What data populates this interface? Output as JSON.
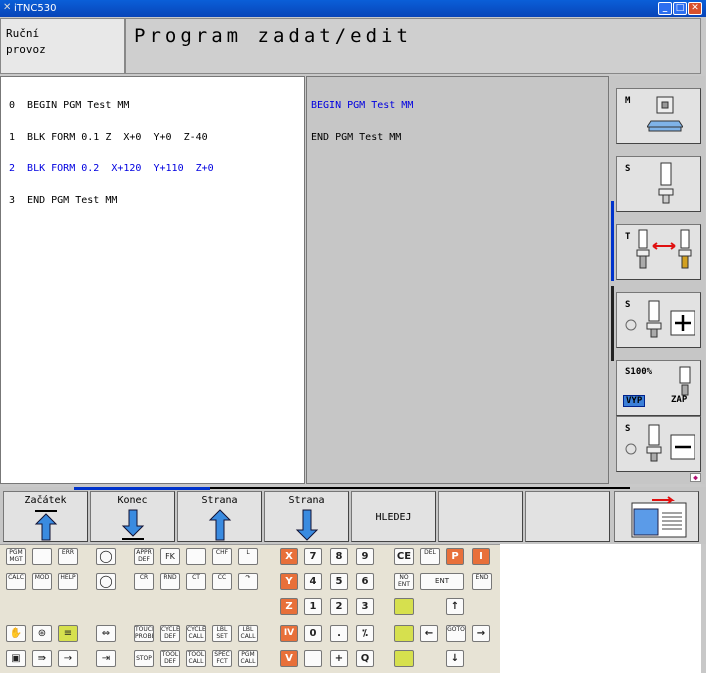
{
  "window": {
    "title": "iTNC530"
  },
  "header": {
    "mode_line1": "Ruční",
    "mode_line2": "provoz",
    "title": "Program zadat/edit"
  },
  "program_lines": [
    {
      "text": "0  BEGIN PGM Test MM",
      "highlight": false
    },
    {
      "text": "1  BLK FORM 0.1 Z  X+0  Y+0  Z-40",
      "highlight": false
    },
    {
      "text": "2  BLK FORM 0.2  X+120  Y+110  Z+0",
      "highlight": true
    },
    {
      "text": "3  END PGM Test MM",
      "highlight": false
    }
  ],
  "mid_lines": [
    {
      "text": "BEGIN PGM Test MM",
      "highlight": true
    },
    {
      "text": "END PGM Test MM",
      "highlight": false
    }
  ],
  "vertical_softkeys": [
    {
      "label": "M",
      "icon": "machine-icon"
    },
    {
      "label": "S",
      "icon": "spindle-icon"
    },
    {
      "label": "T",
      "icon": "tool-change-icon"
    },
    {
      "label": "S",
      "icon": "spindle-increase-icon",
      "extra": "+"
    },
    {
      "label": "S100%",
      "icon": "spindle-override-icon",
      "left": "VYP",
      "right": "ZAP"
    },
    {
      "label": "S",
      "icon": "spindle-decrease-icon",
      "extra": "−"
    }
  ],
  "horizontal_softkeys": [
    "Začátek",
    "Konec",
    "Strana",
    "Strana",
    "HLEDEJ",
    "",
    "",
    ""
  ],
  "keyboard": {
    "row1": [
      "PGM MGT",
      "",
      "ERR",
      "",
      "APPR DEF",
      "FK",
      "CHF",
      "L",
      "X",
      "7",
      "8",
      "9",
      "CE",
      "DEL",
      "P",
      "I"
    ],
    "row2": [
      "CALC",
      "MOD",
      "HELP",
      "",
      "CR",
      "RND",
      "CT",
      "CC",
      "Y",
      "4",
      "5",
      "6",
      "NO ENT",
      "ENT",
      "END"
    ],
    "row3": [
      "Z",
      "1",
      "2",
      "3"
    ],
    "row4": [
      "TOUCH PROBE",
      "CYCLE DEF",
      "CYCLE CALL",
      "LBL SET",
      "LBL CALL",
      "IV",
      "0",
      ".",
      "⁒",
      "GOTO"
    ],
    "row5": [
      "STOP",
      "TOOL DEF",
      "TOOL CALL",
      "SPEC FCT",
      "PGM CALL",
      "V",
      "+",
      "Q"
    ]
  }
}
